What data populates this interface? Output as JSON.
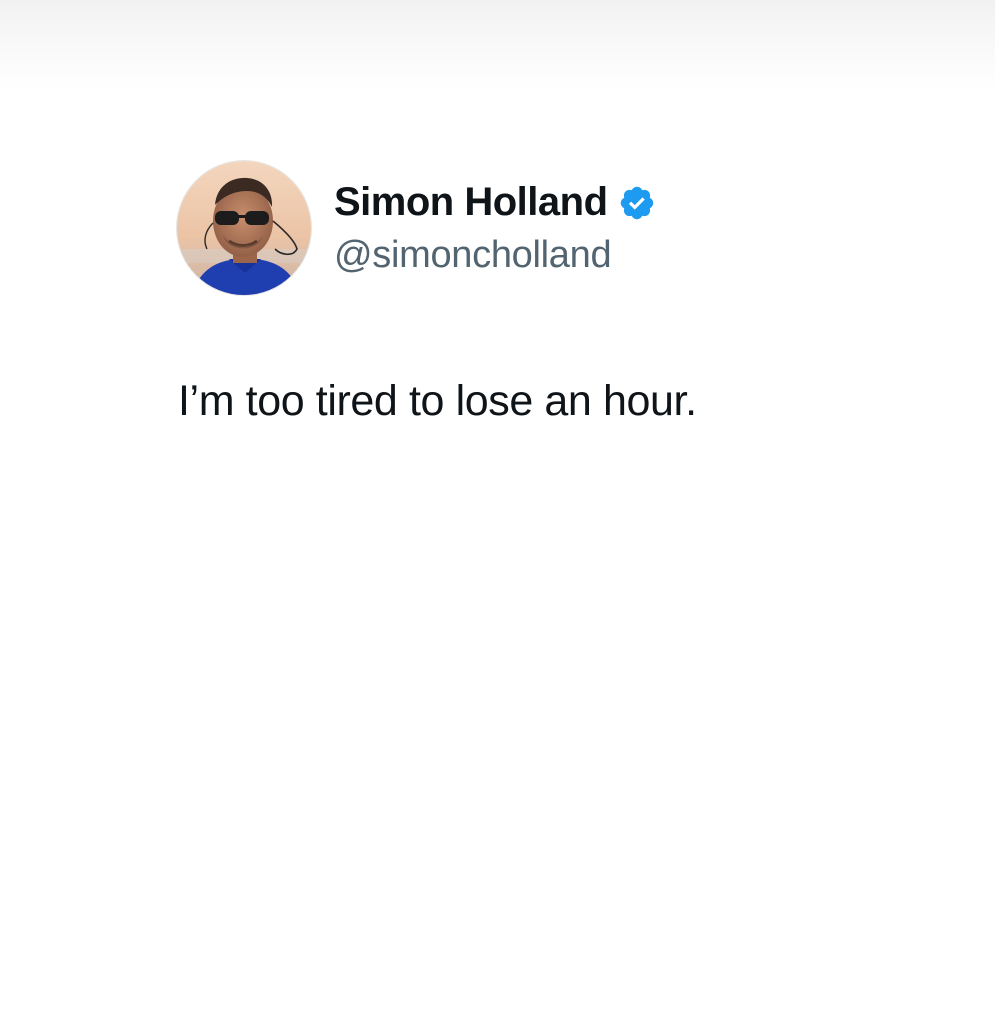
{
  "tweet": {
    "author": {
      "display_name": "Simon Holland",
      "handle": "@simoncholland",
      "verified": true,
      "avatar_icon": "profile-photo"
    },
    "text": "I’m too tired to lose an hour."
  },
  "colors": {
    "background": "#ffffff",
    "name": "#0f1419",
    "handle": "#536471",
    "verified_badge": "#1d9bf0"
  }
}
